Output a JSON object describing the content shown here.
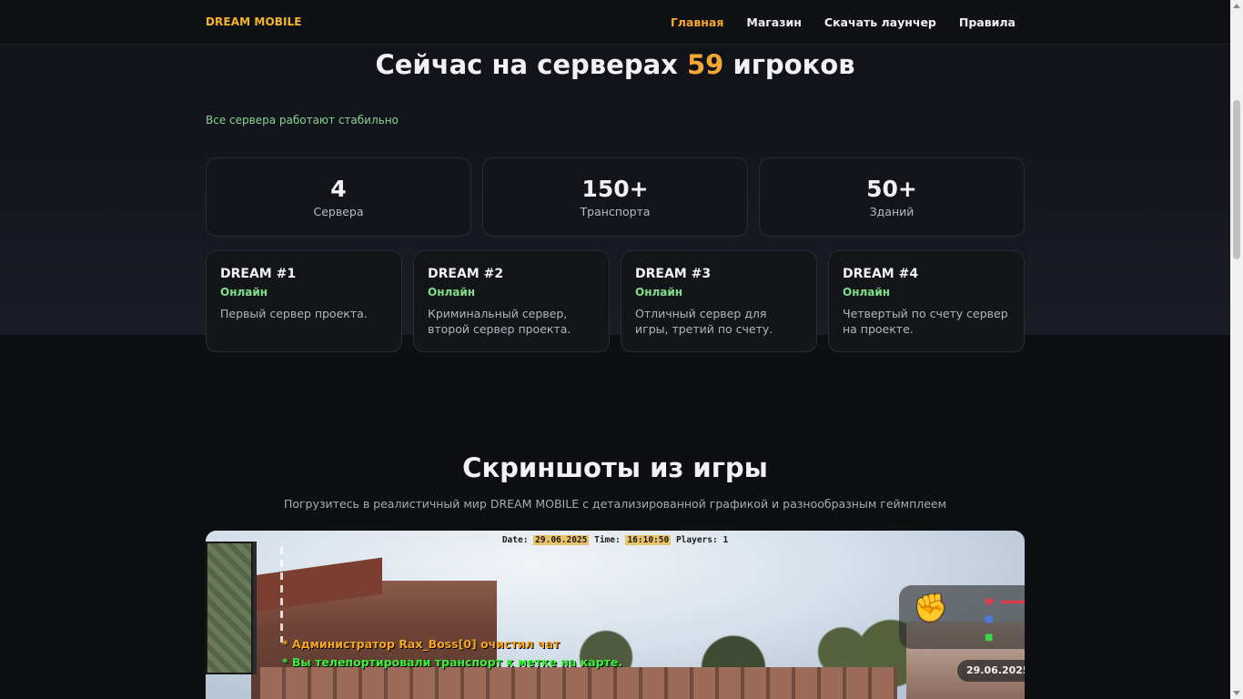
{
  "nav": {
    "logo": "DREAM MOBILE",
    "links": [
      {
        "label": "Главная",
        "active": true
      },
      {
        "label": "Магазин",
        "active": false
      },
      {
        "label": "Скачать лаунчер",
        "active": false
      },
      {
        "label": "Правила",
        "active": false
      }
    ]
  },
  "online": {
    "prefix": "Сейчас на серверах",
    "count": "59",
    "suffix": "игроков",
    "status": "Все сервера работают стабильно"
  },
  "stats": [
    {
      "value": "4",
      "label": "Сервера"
    },
    {
      "value": "150+",
      "label": "Транспорта"
    },
    {
      "value": "50+",
      "label": "Зданий"
    }
  ],
  "servers": [
    {
      "name": "DREAM #1",
      "status": "Онлайн",
      "desc": "Первый сервер проекта."
    },
    {
      "name": "DREAM #2",
      "status": "Онлайн",
      "desc": "Криминальный сервер, второй сервер проекта."
    },
    {
      "name": "DREAM #3",
      "status": "Онлайн",
      "desc": "Отличный сервер для игры, третий по счету."
    },
    {
      "name": "DREAM #4",
      "status": "Онлайн",
      "desc": "Четвертый по счету сервер на проекте."
    }
  ],
  "screenshots": {
    "title": "Скриншоты из игры",
    "subtitle": "Погрузитесь в реалистичный мир DREAM MOBILE с детализированной графикой и разнообразным геймплеем",
    "hud": {
      "date_label": "Date:",
      "date_value": "29.06.2025",
      "time_label": "Time:",
      "time_value": "16:10:50",
      "players_label": "Players:",
      "players_value": "1",
      "chat_1": "* Администратор Rax_Boss[0] очистил чат",
      "chat_2": "* Вы телепортировали транспорт к метке на карте.",
      "date_pill": "29.06.2025"
    }
  },
  "colors": {
    "accent": "#f4a82b",
    "online_green": "#7fe08a",
    "status_green": "#86d38f",
    "background": "#0d0e12"
  },
  "icons": {
    "fist": "fist-icon",
    "heart": "heart-icon",
    "armor": "armor-icon",
    "bag": "bag-icon"
  }
}
